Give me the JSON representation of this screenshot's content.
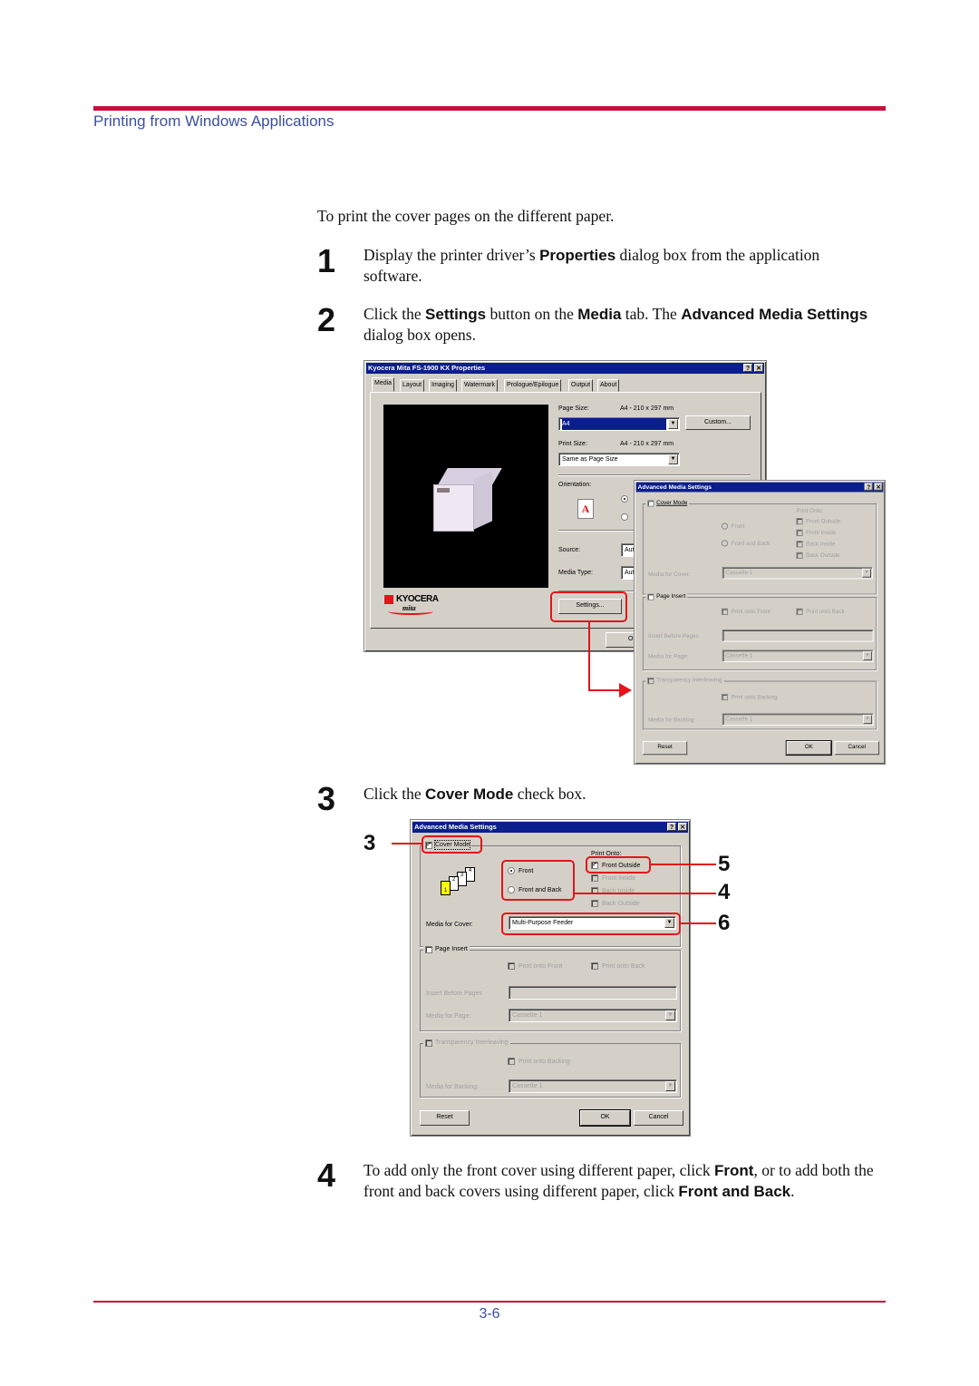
{
  "header": {
    "title": "Printing from Windows Applications"
  },
  "intro": "To print the cover pages on the different paper.",
  "steps": [
    {
      "num": "1",
      "parts": [
        "Display the printer driver’s ",
        "Properties",
        " dialog box from the application software."
      ]
    },
    {
      "num": "2",
      "parts": [
        "Click the ",
        "Settings",
        " button on the ",
        "Media",
        " tab. The ",
        "Advanced Media Settings",
        " dialog box opens."
      ]
    },
    {
      "num": "3",
      "parts": [
        "Click the ",
        "Cover Mode",
        " check box."
      ]
    },
    {
      "num": "4",
      "parts": [
        "To add only the front cover using different paper, click ",
        "Front",
        ", or to add both the front and back covers using different paper, click ",
        "Front and Back",
        "."
      ]
    }
  ],
  "properties_dialog": {
    "title": "Kyocera Mita FS-1900 KX Properties",
    "tabs": [
      "Media",
      "Layout",
      "Imaging",
      "Watermark",
      "Prologue/Epilogue",
      "Output",
      "About"
    ],
    "page_size_label": "Page Size:",
    "page_size_value": "A4 - 210 x 297 mm",
    "page_size_select": "A4",
    "custom_button": "Custom...",
    "print_size_label": "Print Size:",
    "print_size_value": "A4 - 210 x 297 mm",
    "print_size_select": "Same as Page Size",
    "orientation_label": "Orientation:",
    "orientation_icon_letter": "A",
    "source_label": "Source:",
    "source_value": "Aut",
    "media_type_label": "Media Type:",
    "media_type_value": "Aut",
    "settings_button": "Settings...",
    "ok_button": "OK",
    "logo_text": "KYOCERA",
    "logo_sub": "mita"
  },
  "adv_dialog_before": {
    "title": "Advanced Media Settings",
    "cover_mode": "Cover Mode",
    "cover_mode_checked": false,
    "front": "Front",
    "front_and_back": "Front and Back",
    "print_onto": "Print Onto:",
    "front_outside": "Front Outside",
    "front_inside": "Front Inside",
    "back_inside": "Back Inside",
    "back_outside": "Back Outside",
    "media_for_cover": "Media for Cover:",
    "media_for_cover_value": "Cassette 1",
    "page_insert": "Page Insert",
    "print_onto_front": "Print onto Front",
    "print_onto_back": "Print onto Back",
    "insert_before_pages": "Insert Before Pages",
    "media_for_page": "Media for Page:",
    "media_for_page_value": "Cassette 1",
    "transparency": "Transparency Interleaving",
    "print_onto_backing": "Print onto Backing",
    "media_for_backing": "Media for Backing:",
    "media_for_backing_value": "Cassette 1",
    "reset": "Reset",
    "ok": "OK",
    "cancel": "Cancel"
  },
  "adv_dialog_after": {
    "title": "Advanced Media Settings",
    "cover_mode": "Cover Mode",
    "cover_mode_checked": true,
    "front": "Front",
    "front_selected": true,
    "front_and_back": "Front and Back",
    "print_onto": "Print Onto:",
    "front_outside": "Front Outside",
    "front_outside_checked": true,
    "front_inside": "Front Inside",
    "back_inside": "Back Inside",
    "back_outside": "Back Outside",
    "page_icons": [
      "1",
      "2",
      "3",
      "4"
    ],
    "media_for_cover": "Media for Cover:",
    "media_for_cover_value": "Multi-Purpose Feeder",
    "page_insert": "Page Insert",
    "print_onto_front": "Print onto Front",
    "print_onto_back": "Print onto Back",
    "insert_before_pages": "Insert Before Pages",
    "media_for_page": "Media for Page:",
    "media_for_page_value": "Cassette 1",
    "transparency": "Transparency Interleaving",
    "print_onto_backing": "Print onto Backing",
    "media_for_backing": "Media for Backing:",
    "media_for_backing_value": "Cassette 1",
    "reset": "Reset",
    "ok": "OK",
    "cancel": "Cancel"
  },
  "callouts": [
    "3",
    "5",
    "4",
    "6"
  ],
  "colors": {
    "rule": "#c8103c",
    "header_text": "#3b4fa0",
    "callout": "#e3151b",
    "titlebar": "#0a1e8c"
  },
  "footer": {
    "page_number": "3-6"
  }
}
